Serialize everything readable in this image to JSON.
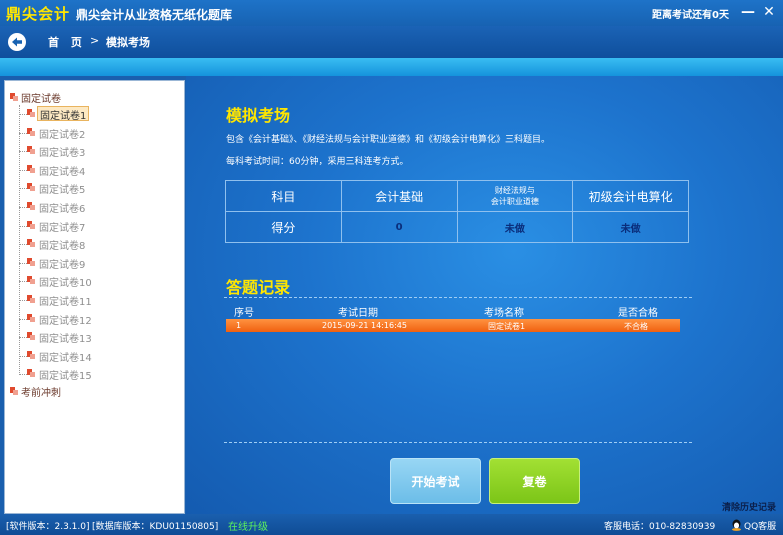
{
  "window": {
    "logo": "鼎尖会计",
    "title": "鼎尖会计从业资格无纸化题库",
    "countdown": "距离考试还有0天",
    "minimize_glyph": "—",
    "close_glyph": "✕"
  },
  "nav": {
    "back_icon": "back-arrow-icon",
    "home": "首 页",
    "separator": ">",
    "current": "模拟考场"
  },
  "sidebar": {
    "fixed_root": "固定试卷",
    "items": [
      "固定试卷1",
      "固定试卷2",
      "固定试卷3",
      "固定试卷4",
      "固定试卷5",
      "固定试卷6",
      "固定试卷7",
      "固定试卷8",
      "固定试卷9",
      "固定试卷10",
      "固定试卷11",
      "固定试卷12",
      "固定试卷13",
      "固定试卷14",
      "固定试卷15"
    ],
    "selected_index": 0,
    "sprint_root": "考前冲刺"
  },
  "main": {
    "title": "模拟考场",
    "desc1": "包含《会计基础》、《财经法规与会计职业道德》和《初级会计电算化》三科题目。",
    "desc2": "每科考试时间：60分钟，采用三科连考方式。",
    "table": {
      "col_subject": "科目",
      "col_basic": "会计基础",
      "col_law_line1": "财经法规与",
      "col_law_line2": "会计职业道德",
      "col_computer": "初级会计电算化",
      "row_label": "得分",
      "score_basic": "0",
      "score_law": "未做",
      "score_computer": "未做"
    },
    "records_title": "答题记录",
    "records_header": {
      "no": "序号",
      "date": "考试日期",
      "name": "考场名称",
      "pass": "是否合格"
    },
    "records": [
      {
        "no": "1",
        "date": "2015-09-21 14:16:45",
        "name": "固定试卷1",
        "pass": "不合格"
      }
    ],
    "start_button": "开始考试",
    "review_button": "复卷",
    "clear_history": "清除历史记录"
  },
  "status": {
    "software_version": "[软件版本：2.3.1.0]",
    "db_version": "[数据库版本：KDU01150805]",
    "upgrade": "在线升级",
    "phone": "客服电话：010-82830939",
    "qq": "QQ客服"
  },
  "colors": {
    "accent_yellow": "#ffe600",
    "record_row": "#f06010",
    "start_button": "#6cbde8",
    "review_button": "#7cc518"
  }
}
